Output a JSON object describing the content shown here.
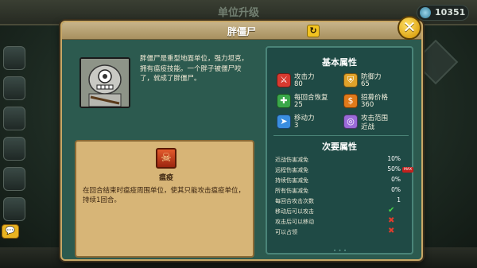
{
  "background": {
    "title": "单位升级",
    "coins": "10351",
    "chat_label": "💬"
  },
  "modal": {
    "title": "胖僵尸",
    "close_label": "✕",
    "badge_label": "↻"
  },
  "unit": {
    "description": "胖僵尸是重型地面单位，强力坦克，拥有瘟疫技能。一个胖子被僵尸咬了，就成了胖僵尸。"
  },
  "skill": {
    "name": "瘟疫",
    "description": "在回合结束时瘟疫周围单位，使其只能攻击瘟疫单位，持续1回合。"
  },
  "basic_stats": {
    "title": "基本属性",
    "items": [
      {
        "label": "攻击力",
        "value": "80",
        "color": "#d83a30",
        "icon": "sword-icon"
      },
      {
        "label": "防御力",
        "value": "65",
        "color": "#e0a22a",
        "icon": "shield-icon"
      },
      {
        "label": "每回合恢复",
        "value": "25",
        "color": "#3aa84a",
        "icon": "heal-icon"
      },
      {
        "label": "招募价格",
        "value": "360",
        "color": "#e07a1a",
        "icon": "coin-icon"
      },
      {
        "label": "移动力",
        "value": "3",
        "color": "#3a8ee0",
        "icon": "boot-icon"
      },
      {
        "label": "攻击范围",
        "value": "近战",
        "color": "#9a6ad8",
        "icon": "range-icon"
      }
    ]
  },
  "secondary_stats": {
    "title": "次要属性",
    "rows": [
      {
        "label": "近战伤害减免",
        "value": "10%"
      },
      {
        "label": "远程伤害减免",
        "value": "50%",
        "badge": "MAX"
      },
      {
        "label": "持续伤害减免",
        "value": "0%"
      },
      {
        "label": "所有伤害减免",
        "value": "0%"
      },
      {
        "label": "每回合攻击次数",
        "value": "1"
      },
      {
        "label": "移动后可以攻击",
        "check": "✔"
      },
      {
        "label": "攻击后可以移动",
        "check": "✖"
      },
      {
        "label": "可以占领",
        "check": "✖"
      }
    ]
  }
}
